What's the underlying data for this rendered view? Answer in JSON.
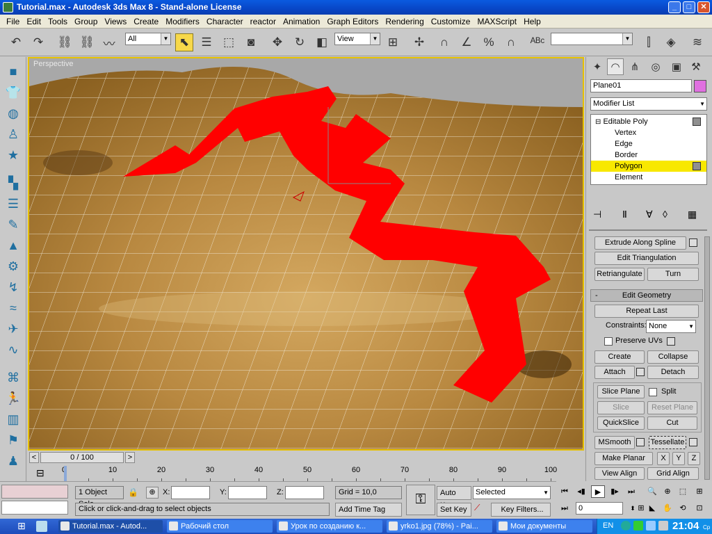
{
  "window": {
    "title": "Tutorial.max - Autodesk 3ds Max 8  - Stand-alone License",
    "minimize": "_",
    "maximize": "□",
    "close": "✕"
  },
  "menu": [
    "File",
    "Edit",
    "Tools",
    "Group",
    "Views",
    "Create",
    "Modifiers",
    "Character",
    "reactor",
    "Animation",
    "Graph Editors",
    "Rendering",
    "Customize",
    "MAXScript",
    "Help"
  ],
  "toolbar": {
    "selection_filter": "All",
    "ref_coord": "View",
    "named_selection": ""
  },
  "viewport": {
    "label": "Perspective"
  },
  "command_panel": {
    "object_name": "Plane01",
    "object_color": "#e070e0",
    "modifier_list": "Modifier List",
    "stack": [
      {
        "label": "Editable Poly",
        "level": 0,
        "expand": "⊟"
      },
      {
        "label": "Vertex",
        "level": 1
      },
      {
        "label": "Edge",
        "level": 1
      },
      {
        "label": "Border",
        "level": 1
      },
      {
        "label": "Polygon",
        "level": 1,
        "selected": true
      },
      {
        "label": "Element",
        "level": 1
      }
    ],
    "extrude_along_spline": "Extrude Along Spline",
    "edit_triangulation": "Edit Triangulation",
    "retriangulate": "Retriangulate",
    "turn": "Turn",
    "rollout_minus": "-",
    "edit_geometry_title": "Edit Geometry",
    "repeat_last": "Repeat Last",
    "constraints_label": "Constraints:",
    "constraints_value": "None",
    "preserve_uvs": "Preserve UVs",
    "create": "Create",
    "collapse": "Collapse",
    "attach": "Attach",
    "detach": "Detach",
    "slice_plane": "Slice Plane",
    "split": "Split",
    "slice": "Slice",
    "reset_plane": "Reset Plane",
    "quickslice": "QuickSlice",
    "cut": "Cut",
    "msmooth": "MSmooth",
    "tessellate": "Tessellate",
    "make_planar": "Make Planar",
    "x": "X",
    "y": "Y",
    "z": "Z",
    "view_align": "View Align",
    "grid_align": "Grid Align"
  },
  "timeline": {
    "frame_display": "0 / 100",
    "prev": "<",
    "next": ">",
    "tick_labels": [
      "0",
      "10",
      "20",
      "30",
      "40",
      "50",
      "60",
      "70",
      "80",
      "90",
      "100"
    ]
  },
  "status": {
    "selection": "1 Object Sele",
    "x_label": "X:",
    "y_label": "Y:",
    "z_label": "Z:",
    "grid": "Grid = 10,0",
    "prompt": "Click or click-and-drag to select objects",
    "add_time_tag": "Add Time Tag",
    "auto_key": "Auto Key",
    "set_key": "Set Key",
    "key_mode": "Selected",
    "key_filters": "Key Filters...",
    "current_frame": "0"
  },
  "taskbar": {
    "tasks": [
      {
        "label": "Tutorial.max - Autod...",
        "active": true
      },
      {
        "label": "Рабочий стол",
        "active": false
      },
      {
        "label": "Урок по созданию к...",
        "active": false
      },
      {
        "label": "yrko1.jpg (78%) - Pai...",
        "active": false
      },
      {
        "label": "Мои документы",
        "active": false
      }
    ],
    "lang": "EN",
    "time": "21:04",
    "day": "Ср"
  }
}
